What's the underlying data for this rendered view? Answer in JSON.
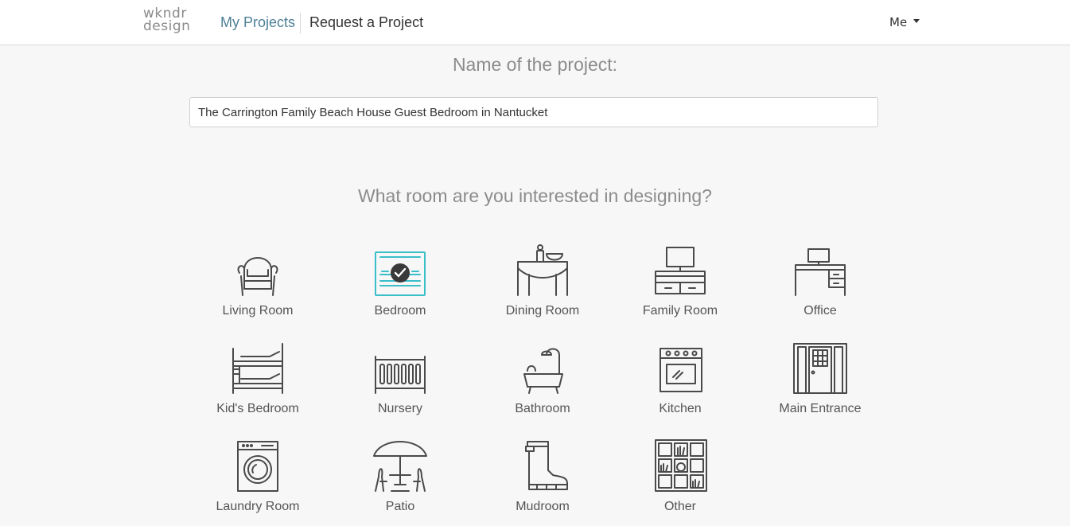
{
  "header": {
    "logo_line1": "wkndr",
    "logo_line2": "design",
    "nav_my_projects": "My Projects",
    "nav_request": "Request a Project",
    "user_menu": "Me"
  },
  "form": {
    "name_heading": "Name of the project:",
    "project_name": "The Carrington Family Beach House Guest Bedroom in Nantucket",
    "room_heading": "What room are you interested in designing?"
  },
  "rooms": [
    {
      "label": "Living Room",
      "icon": "armchair-icon",
      "selected": false
    },
    {
      "label": "Bedroom",
      "icon": "bed-icon",
      "selected": true
    },
    {
      "label": "Dining Room",
      "icon": "dining-table-icon",
      "selected": false
    },
    {
      "label": "Family Room",
      "icon": "tv-stand-icon",
      "selected": false
    },
    {
      "label": "Office",
      "icon": "desk-icon",
      "selected": false
    },
    {
      "label": "Kid's Bedroom",
      "icon": "bunk-bed-icon",
      "selected": false
    },
    {
      "label": "Nursery",
      "icon": "crib-icon",
      "selected": false
    },
    {
      "label": "Bathroom",
      "icon": "bathtub-icon",
      "selected": false
    },
    {
      "label": "Kitchen",
      "icon": "oven-icon",
      "selected": false
    },
    {
      "label": "Main Entrance",
      "icon": "front-door-icon",
      "selected": false
    },
    {
      "label": "Laundry Room",
      "icon": "washing-machine-icon",
      "selected": false
    },
    {
      "label": "Patio",
      "icon": "patio-umbrella-icon",
      "selected": false
    },
    {
      "label": "Mudroom",
      "icon": "boot-icon",
      "selected": false
    },
    {
      "label": "Other",
      "icon": "shelves-icon",
      "selected": false
    }
  ],
  "colors": {
    "accent": "#3bbfc9",
    "nav_active": "#4e7f96"
  }
}
